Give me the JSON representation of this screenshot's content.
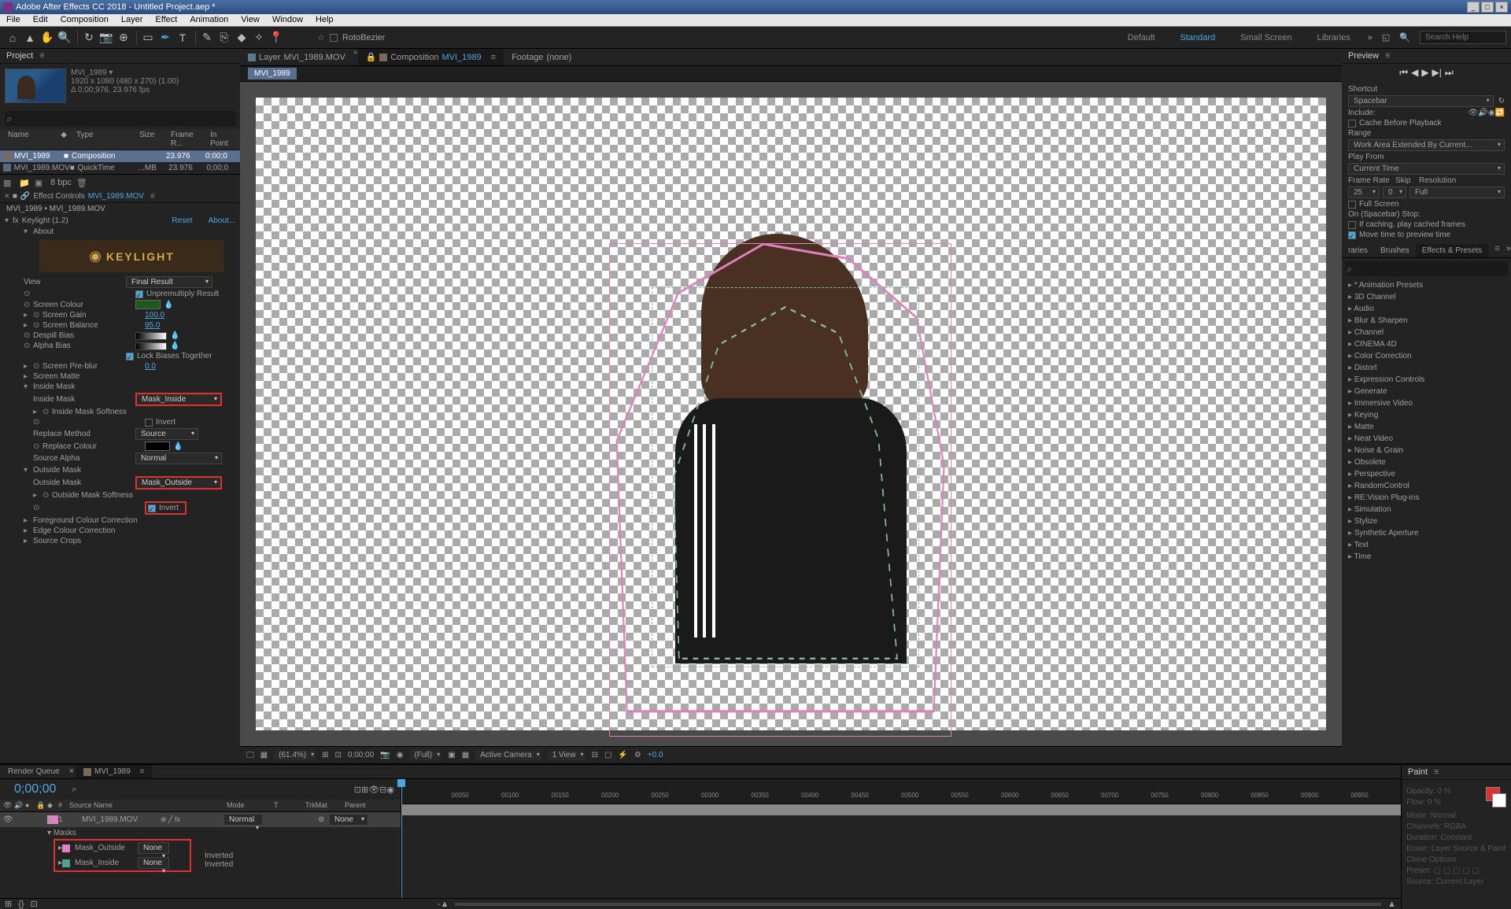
{
  "titlebar": {
    "text": "Adobe After Effects CC 2018 - Untitled Project.aep *"
  },
  "menubar": [
    "File",
    "Edit",
    "Composition",
    "Layer",
    "Effect",
    "Animation",
    "View",
    "Window",
    "Help"
  ],
  "toolbar_mid": {
    "roto_label": "RotoBezier"
  },
  "workspaces": {
    "default": "Default",
    "standard": "Standard",
    "small": "Small Screen",
    "libraries": "Libraries",
    "search_placeholder": "Search Help"
  },
  "project": {
    "title": "Project",
    "comp_name": "MVI_1989",
    "comp_info1": "1920 x 1080 (480 x 270) (1.00)",
    "comp_info2": "Δ 0;00;976, 23.976 fps",
    "cols": {
      "name": "Name",
      "type": "Type",
      "size": "Size",
      "frame": "Frame R...",
      "in": "In Point"
    },
    "row1": {
      "name": "MVI_1989",
      "type": "Composition",
      "frame": "23.976",
      "in": "0;00;0"
    },
    "row2": {
      "name": "MVI_1989.MOV",
      "type": "QuickTime",
      "size": "...MB",
      "frame": "23.976",
      "in": "0;00;0"
    },
    "bpc": "8 bpc"
  },
  "effect_controls": {
    "title": "Effect Controls",
    "layer": "MVI_1989.MOV",
    "breadcrumb": "MVI_1989 • MVI_1989.MOV",
    "fx_name": "Keylight (1.2)",
    "reset": "Reset",
    "about": "About...",
    "about_sub": "About",
    "keylight_brand": "KEYLIGHT",
    "view_label": "View",
    "view_value": "Final Result",
    "unpremult": "Unpremultiply Result",
    "screen_colour": "Screen Colour",
    "screen_gain": "Screen Gain",
    "screen_gain_val": "100.0",
    "screen_balance": "Screen Balance",
    "screen_balance_val": "95.0",
    "despill": "Despill Bias",
    "alpha_bias": "Alpha Bias",
    "lock_biases": "Lock Biases Together",
    "preblur": "Screen Pre-blur",
    "preblur_val": "0.0",
    "screen_matte": "Screen Matte",
    "inside_mask": "Inside Mask",
    "inside_mask_sel": "Inside Mask",
    "inside_mask_val": "Mask_Inside",
    "inside_softness": "Inside Mask Softness",
    "invert": "Invert",
    "replace_method": "Replace Method",
    "replace_method_val": "Source",
    "replace_colour": "Replace Colour",
    "source_alpha": "Source Alpha",
    "source_alpha_val": "Normal",
    "outside_mask": "Outside Mask",
    "outside_mask_sel": "Outside Mask",
    "outside_mask_val": "Mask_Outside",
    "outside_softness": "Outside Mask Softness",
    "fg_colour": "Foreground Colour Correction",
    "edge_colour": "Edge Colour Correction",
    "source_crops": "Source Crops"
  },
  "center": {
    "tab_layer": "Layer",
    "tab_layer_name": "MVI_1989.MOV",
    "tab_comp": "Composition",
    "tab_comp_name": "MVI_1989",
    "tab_footage": "Footage",
    "tab_footage_name": "(none)",
    "subtab": "MVI_1989",
    "zoom": "(61.4%)",
    "timecode": "0;00;00",
    "full": "(Full)",
    "camera": "Active Camera",
    "views": "1 View",
    "exposure": "+0.0"
  },
  "preview": {
    "title": "Preview",
    "shortcut": "Shortcut",
    "shortcut_val": "Spacebar",
    "include": "Include:",
    "cache_before": "Cache Before Playback",
    "range": "Range",
    "range_val": "Work Area Extended By Current...",
    "play_from": "Play From",
    "play_from_val": "Current Time",
    "frame_rate": "Frame Rate",
    "skip": "Skip",
    "resolution": "Resolution",
    "fr_val": "25",
    "skip_val": "0",
    "res_val": "Full",
    "full_screen": "Full Screen",
    "spacebar_stop": "On (Spacebar) Stop:",
    "if_caching": "If caching, play cached frames",
    "move_time": "Move time to preview time"
  },
  "effects_presets": {
    "tab_libraries": "raries",
    "tab_brushes": "Brushes",
    "tab_effects": "Effects & Presets",
    "items": [
      "* Animation Presets",
      "3D Channel",
      "Audio",
      "Blur & Sharpen",
      "Channel",
      "CINEMA 4D",
      "Color Correction",
      "Distort",
      "Expression Controls",
      "Generate",
      "Immersive Video",
      "Keying",
      "Matte",
      "Neat Video",
      "Noise & Grain",
      "Obsolete",
      "Perspective",
      "RandomControl",
      "RE:Vision Plug-ins",
      "Simulation",
      "Stylize",
      "Synthetic Aperture",
      "Text",
      "Time"
    ]
  },
  "timeline": {
    "tab_rq": "Render Queue",
    "tab_comp": "MVI_1989",
    "timecode": "0;00;00",
    "cols": {
      "source": "Source Name",
      "mode": "Mode",
      "trkmat": "TrkMat",
      "parent": "Parent"
    },
    "layer1": {
      "num": "1",
      "name": "MVI_1989.MOV",
      "mode": "Normal",
      "parent": "None"
    },
    "masks_label": "Masks",
    "mask1": {
      "name": "Mask_Outside",
      "mode": "None",
      "inv": "Inverted"
    },
    "mask2": {
      "name": "Mask_Inside",
      "mode": "None",
      "inv": "Inverted"
    },
    "ruler_ticks": [
      "00050",
      "00100",
      "00150",
      "00200",
      "00250",
      "00300",
      "00350",
      "00400",
      "00450",
      "00500",
      "00550",
      "00600",
      "00650",
      "00700",
      "00750",
      "00800",
      "00850",
      "00900",
      "00950"
    ]
  },
  "paint": {
    "title": "Paint",
    "opacity": "Opacity:",
    "opacity_val": "0 %",
    "flow": "Flow:",
    "flow_val": "0 %",
    "mode": "Mode:",
    "mode_val": "Normal",
    "channels": "Channels:",
    "channels_val": "RGBA",
    "duration": "Duration:",
    "duration_val": "Constant",
    "erase": "Erase:",
    "erase_val": "Layer Source & Paint",
    "clone": "Clone Options",
    "preset": "Preset:",
    "source": "Source:",
    "source_val": "Current Layer"
  }
}
